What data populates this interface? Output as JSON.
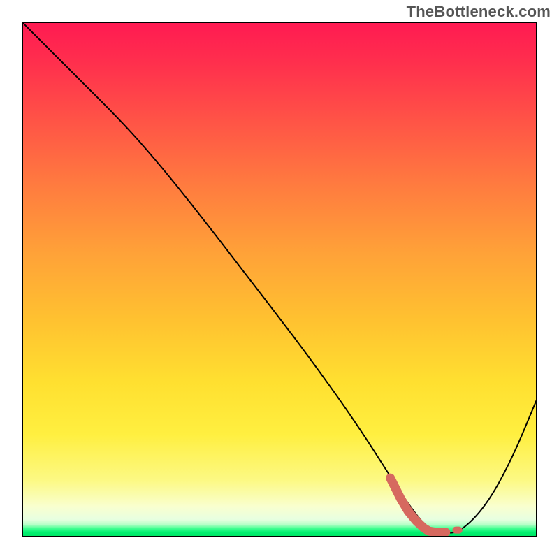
{
  "watermark": "TheBottleneck.com",
  "chart_data": {
    "type": "line",
    "title": "",
    "xlabel": "",
    "ylabel": "",
    "xlim": [
      0,
      100
    ],
    "ylim": [
      0,
      100
    ],
    "grid": false,
    "series": [
      {
        "name": "bottleneck-curve",
        "color": "#000000",
        "x": [
          0,
          10,
          20,
          27,
          35,
          45,
          55,
          65,
          72,
          76,
          79,
          82,
          85,
          90,
          95,
          100
        ],
        "y": [
          100,
          90,
          80,
          72,
          62,
          49,
          36,
          22,
          11,
          5,
          1.5,
          0.8,
          1,
          6,
          15,
          27
        ]
      }
    ],
    "markers": {
      "name": "highlight-region",
      "color": "#d6695f",
      "points_x": [
        71.5,
        72.5,
        73.5,
        75.0,
        76.5,
        78.0,
        79.0,
        80.2,
        81.0,
        82.0,
        83.2,
        84.5
      ],
      "points_y": [
        11.5,
        9.5,
        7.5,
        5.0,
        3.2,
        1.8,
        1.2,
        1.0,
        1.0,
        1.0,
        1.2,
        1.4
      ],
      "style": "thick-dashed"
    },
    "gradient": {
      "direction": "vertical",
      "stops": [
        {
          "pos": 0.0,
          "color": "#ff1a52"
        },
        {
          "pos": 0.45,
          "color": "#ffa238"
        },
        {
          "pos": 0.8,
          "color": "#ffef40"
        },
        {
          "pos": 0.965,
          "color": "#e8ffe0"
        },
        {
          "pos": 1.0,
          "color": "#00e060"
        }
      ]
    }
  }
}
